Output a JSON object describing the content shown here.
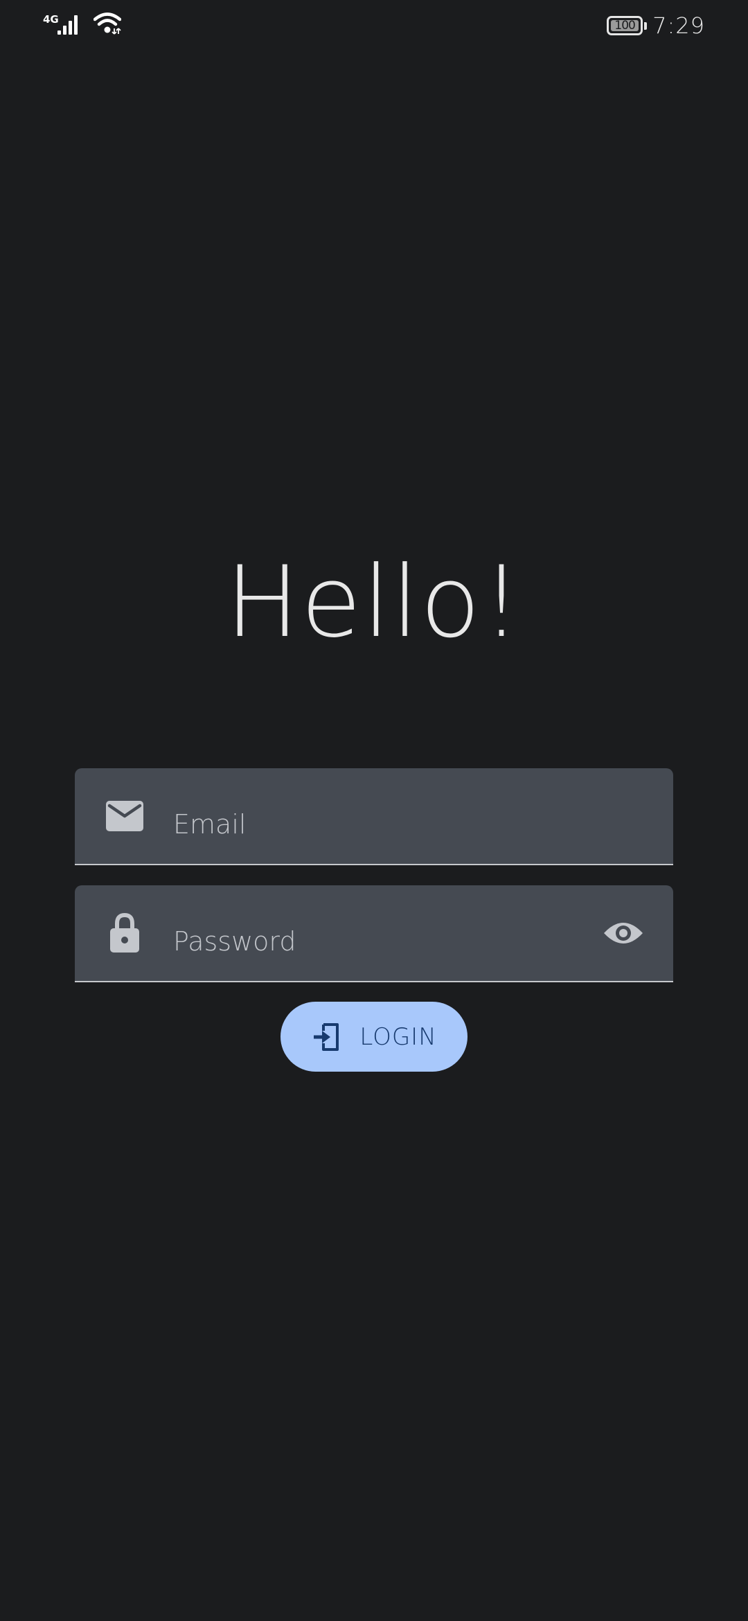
{
  "status_bar": {
    "network_type": "4G",
    "battery_level": "100",
    "time": "7:29",
    "signal_icon": "signal-bars-icon",
    "wifi_icon": "wifi-icon",
    "battery_icon": "battery-icon"
  },
  "title": "Hello!",
  "email_field": {
    "placeholder": "Email",
    "value": "",
    "icon": "mail-icon"
  },
  "password_field": {
    "placeholder": "Password",
    "value": "",
    "icon": "lock-icon",
    "toggle_icon": "eye-icon"
  },
  "login_button": {
    "label": "LOGIN",
    "icon": "login-icon"
  },
  "colors": {
    "background": "#1b1c1e",
    "field_background": "#454a52",
    "field_underline": "#c7c9cd",
    "button_background": "#a8c8fb",
    "button_text": "#173a6e",
    "text_primary": "#e8e8e8",
    "placeholder_text": "#c4c7cc"
  }
}
